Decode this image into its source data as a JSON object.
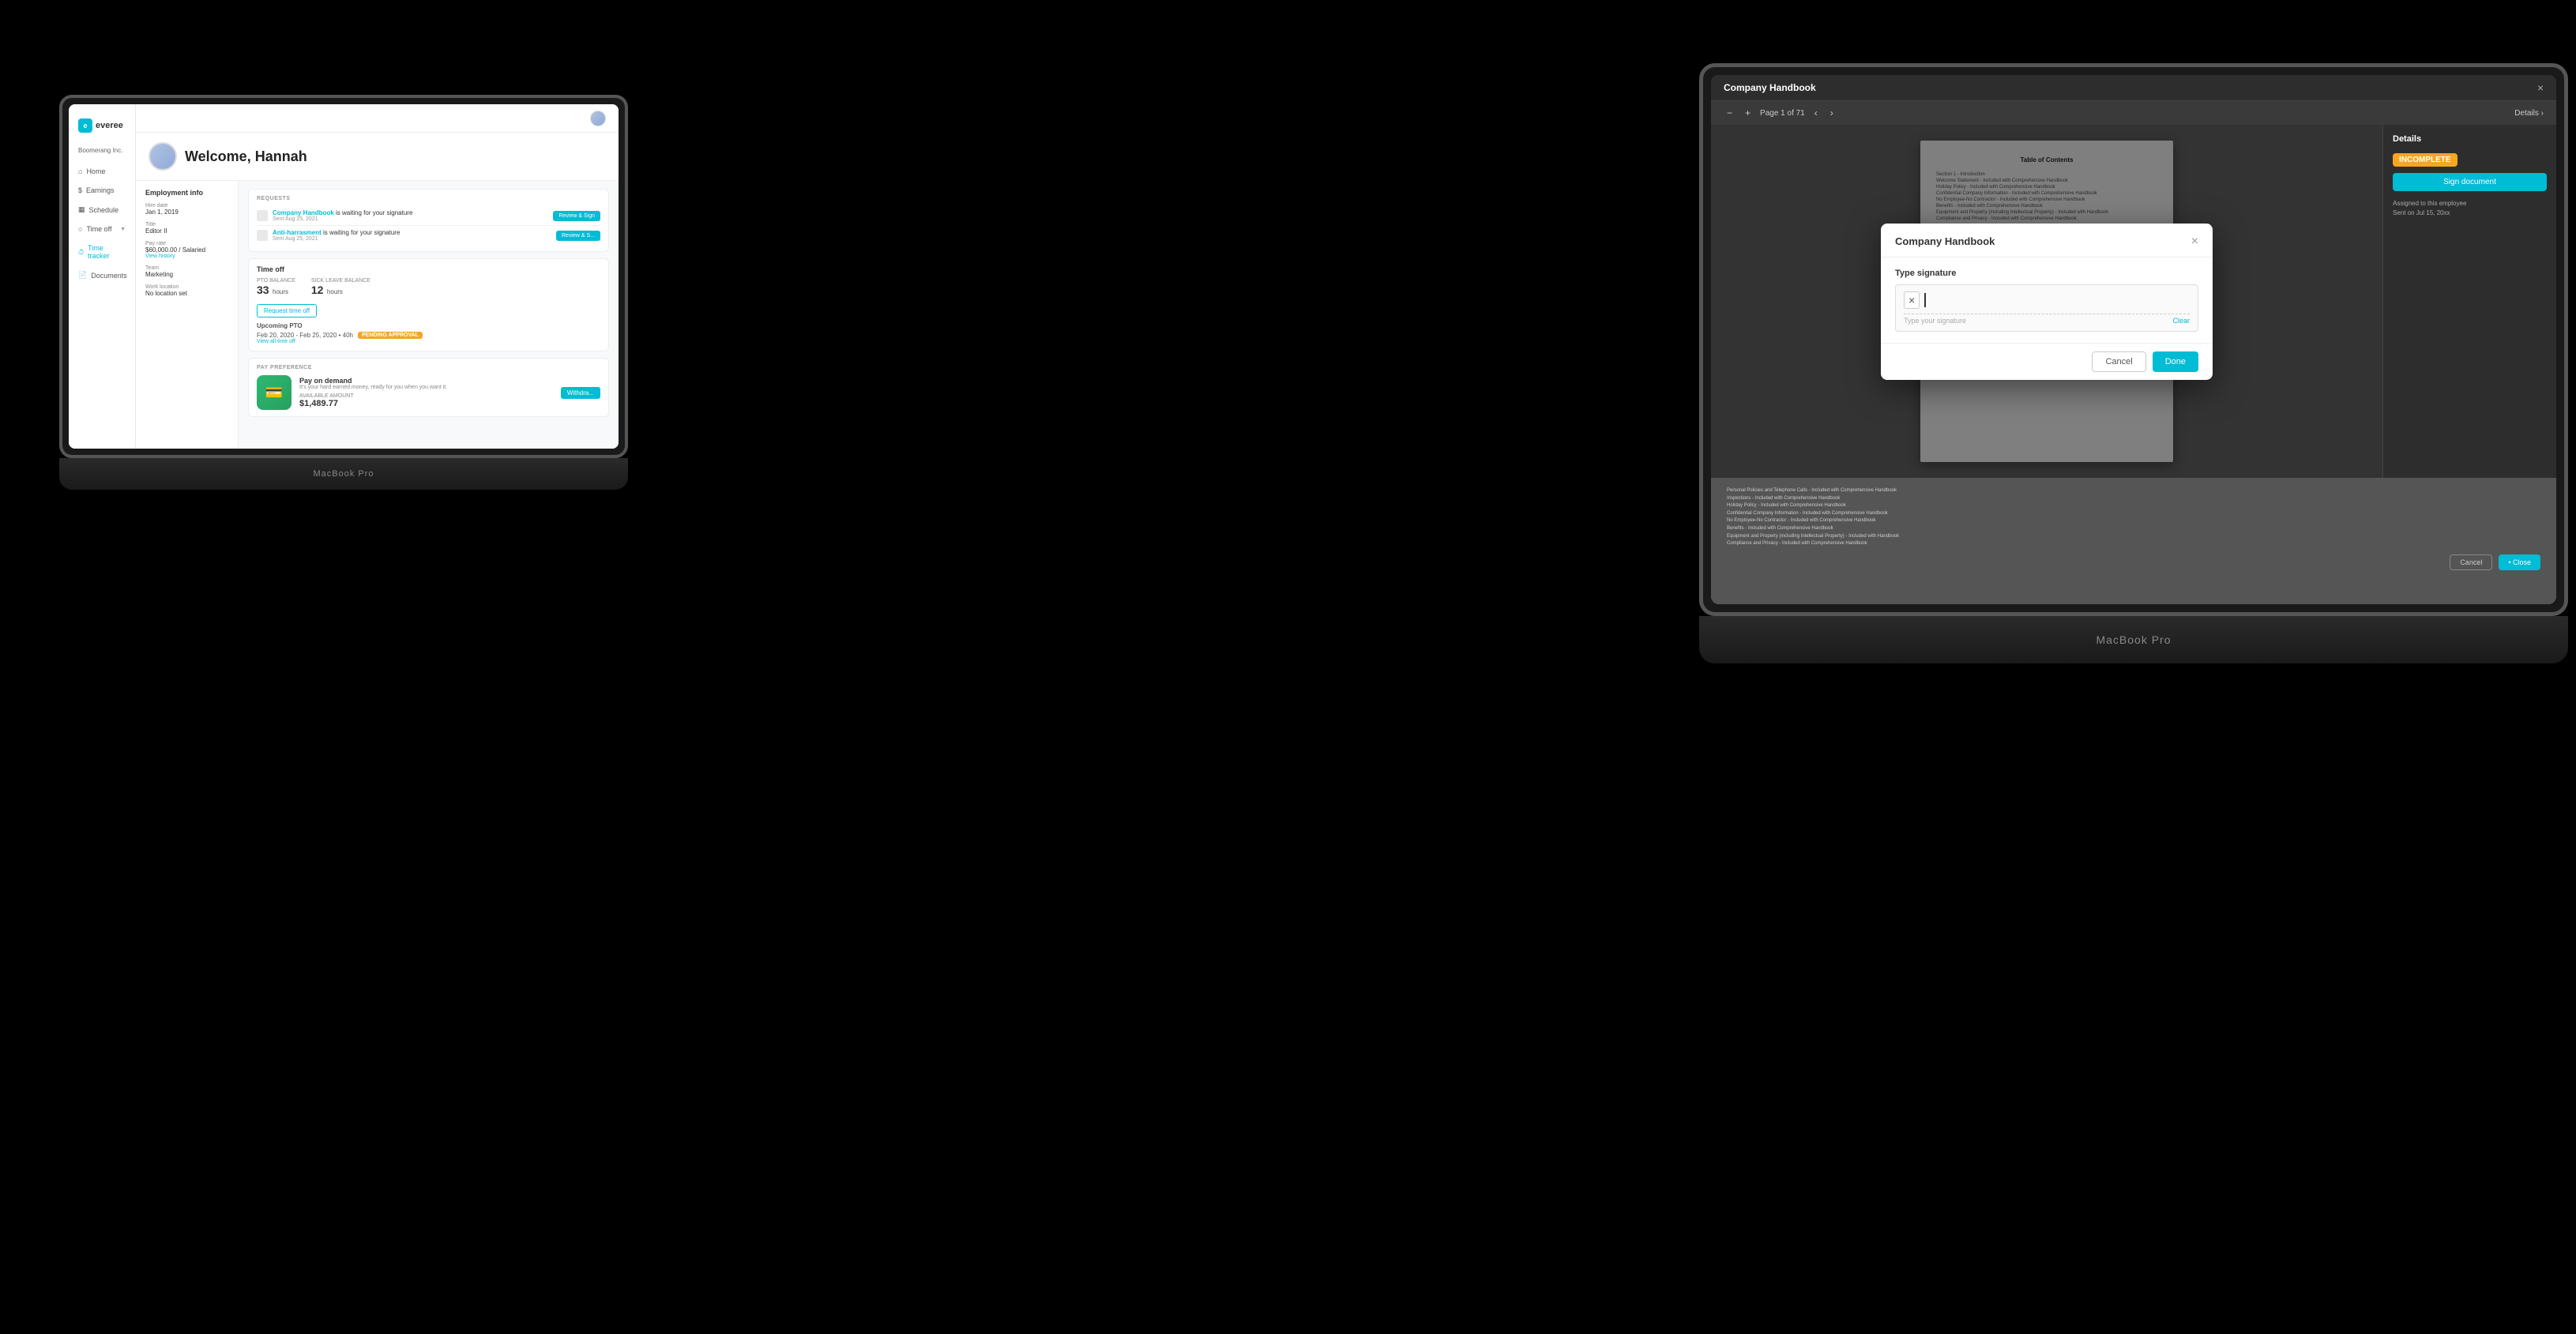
{
  "laptop1": {
    "label": "MacBook Pro",
    "sidebar": {
      "logo": "everee",
      "company": "Boomerang Inc.",
      "nav": [
        {
          "id": "home",
          "label": "Home",
          "icon": "home"
        },
        {
          "id": "earnings",
          "label": "Earnings",
          "icon": "dollar"
        },
        {
          "id": "schedule",
          "label": "Schedule",
          "icon": "calendar"
        },
        {
          "id": "time-off",
          "label": "Time off",
          "icon": "clock",
          "hasChevron": true
        },
        {
          "id": "time-tracker",
          "label": "Time tracker",
          "icon": "clock2"
        },
        {
          "id": "documents",
          "label": "Documents",
          "icon": "file"
        }
      ]
    },
    "welcome": {
      "greeting": "Welcome, Hannah"
    },
    "employment": {
      "title": "Employment info",
      "fields": [
        {
          "label": "Hire date",
          "value": "Jan 1, 2019"
        },
        {
          "label": "Title",
          "value": "Editor II"
        },
        {
          "label": "Pay rate",
          "value": "$60,000.00 / Salaried",
          "link": "View history"
        },
        {
          "label": "Team",
          "value": "Marketing"
        },
        {
          "label": "Work location",
          "value": "No location set"
        }
      ]
    },
    "requests": {
      "label": "REQUESTS",
      "items": [
        {
          "title": "Company Handbook",
          "linkText": "Company Handbook",
          "suffix": " is waiting for your signature",
          "date": "Sent Aug 25, 2021",
          "btnLabel": "Review & Sign"
        },
        {
          "title": "Anti-harrasment",
          "linkText": "Anti-harrasment",
          "suffix": " is waiting for your signature",
          "date": "Sent Aug 25, 2021",
          "btnLabel": "Review & S..."
        }
      ]
    },
    "timeoff": {
      "title": "Time off",
      "ptoLabel": "PTO BALANCE",
      "ptoValue": "33 hours",
      "sickLabel": "SICK LEAVE BALANCE",
      "sickValue": "12 hours",
      "requestBtn": "Request time off",
      "upcomingLabel": "Upcoming PTO",
      "upcomingDates": "Feb 20, 2020 - Feb 25, 2020 • 40h",
      "pendingBadge": "PENDING APPROVAL",
      "viewAll": "View all time off"
    },
    "payPreference": {
      "title": "Pay preference",
      "cardTitle": "Pay on demand",
      "cardDesc": "It's your hard earned money, ready for you when you want it.",
      "availableLabel": "AVAILABLE AMOUNT",
      "amount": "$1,489.77",
      "withdrawBtn": "Withdra..."
    }
  },
  "laptop2": {
    "label": "MacBook Pro",
    "handbookTitle": "Company Handbook",
    "closeLabel": "×",
    "toolbar": {
      "zoomOut": "−",
      "zoomIn": "+",
      "pageInfo": "Page 1 of 71",
      "navLeft": "‹",
      "navRight": "›",
      "details": "Details",
      "detailsIcon": "›"
    },
    "docPage": {
      "title": "Table of Contents",
      "items": [
        "Section 1 - Introduction",
        "Welcome Statement - Included with Comprehensive Handbook",
        "Holiday Policy - Included with Comprehensive Handbook",
        "Confidential Company Information - Included with Comprehensive Handbook",
        "No Employee-No Contractor - Included with Comprehensive Handbook",
        "Benefits - Included with Comprehensive Handbook",
        "Equipment and Property (including Intellectual Property) - Included with",
        "Handbook",
        "Compliance and Privacy - Included with Comprehensive Handbook"
      ]
    },
    "detailsPanel": {
      "title": "Details",
      "incompleteBadge": "INCOMPLETE",
      "signBtn": "Sign document",
      "infoText": "Assigned to this employee\nSent on Jul 15, 20xx"
    },
    "bottomContent": {
      "lines": [
        "Personal Policies and Telephone Calls - Included with Comprehensive",
        "Handbook",
        "Inspections - Included with Comprehensive Handbook",
        "Holiday Policy - Included with Comprehensive Handbook",
        "Confidential Company Information - Included with Comprehensive Handbook",
        "No Employee-No Contractor - Included with Comprehensive Handbook",
        "Benefits - Included with Comprehensive Handbook",
        "Equipment and Property (including Intellectual Property) - Included with",
        "Handbook",
        "Compliance and Privacy - Included with Comprehensive Handbook"
      ],
      "cancelBtn": "Cancel",
      "closeBtn": "• Close"
    },
    "modal": {
      "title": "Company Handbook",
      "sigLabel": "Type signature",
      "placeholder": "Type your signature",
      "clearLabel": "Clear",
      "cancelBtn": "Cancel",
      "doneBtn": "Done"
    }
  }
}
